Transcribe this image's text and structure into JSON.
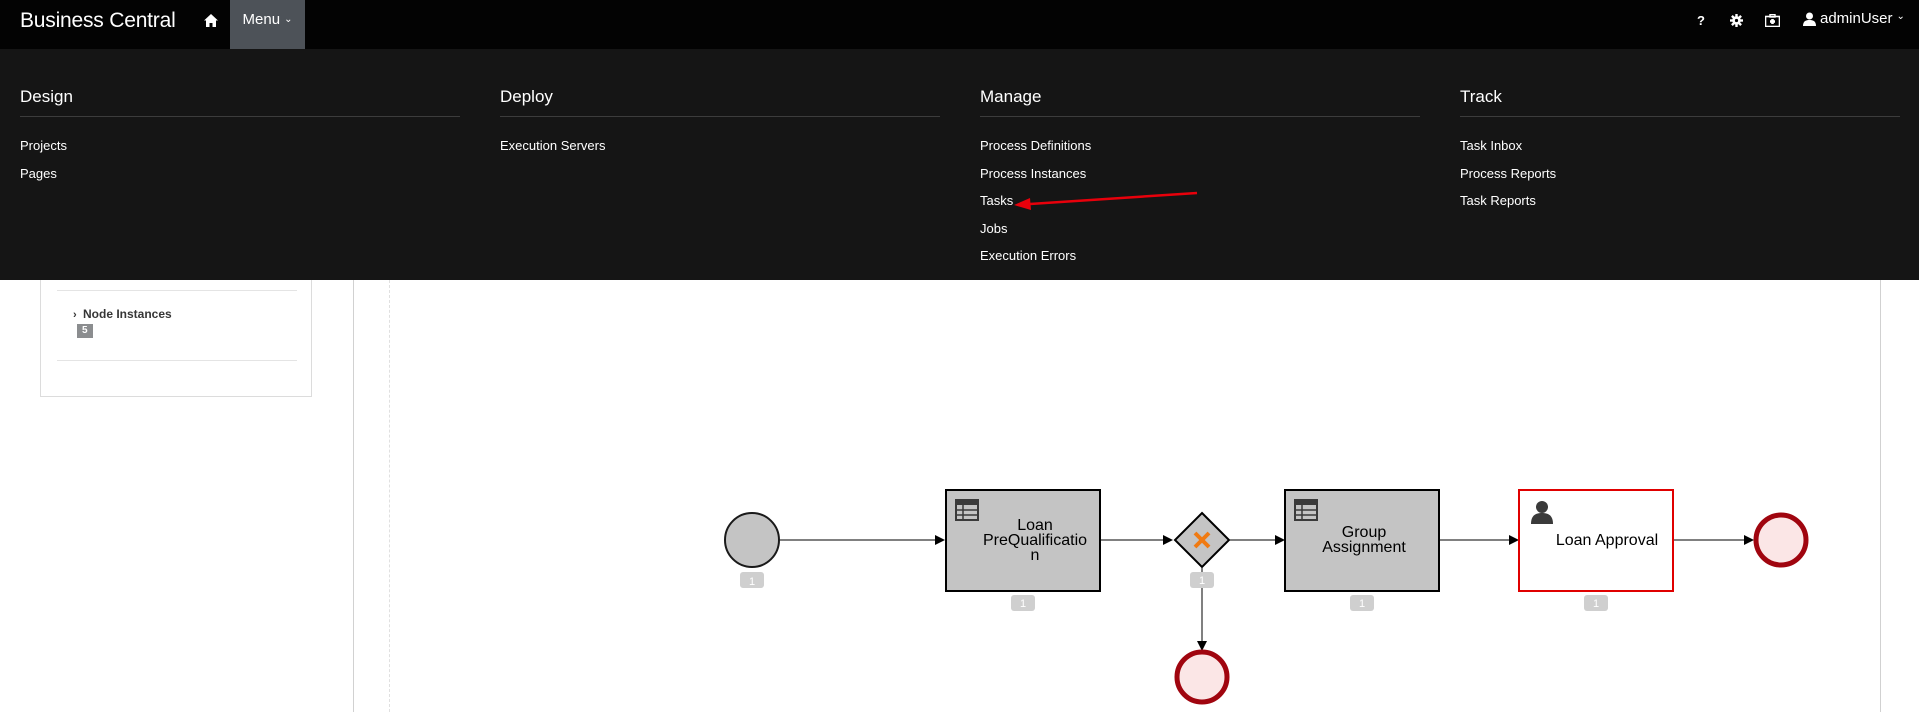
{
  "app": {
    "title": "Business Central"
  },
  "topbar": {
    "menu_label": "Menu",
    "user_name": "adminUser",
    "help_glyph": "?"
  },
  "menu": {
    "design": {
      "title": "Design",
      "items": [
        "Projects",
        "Pages"
      ]
    },
    "deploy": {
      "title": "Deploy",
      "items": [
        "Execution Servers"
      ]
    },
    "manage": {
      "title": "Manage",
      "items": [
        "Process Definitions",
        "Process Instances",
        "Tasks",
        "Jobs",
        "Execution Errors"
      ]
    },
    "track": {
      "title": "Track",
      "items": [
        "Task Inbox",
        "Process Reports",
        "Task Reports"
      ]
    }
  },
  "sidebar": {
    "node_instances_label": "Node Instances",
    "node_instances_count": "5"
  },
  "diagram": {
    "tasks": {
      "prequal": [
        "Loan",
        "PreQualificatio",
        "n"
      ],
      "group": [
        "Group",
        "Assignment"
      ],
      "approval": "Loan Approval"
    },
    "badges": {
      "start": "1",
      "prequal": "1",
      "gateway": "1",
      "group": "1",
      "approval": "1"
    }
  },
  "colors": {
    "topbar": "#030303",
    "menu_bg": "#151515",
    "menu_active": "#4d5258",
    "annotation_arrow": "#e8000b",
    "gateway_x": "#f07a12",
    "end_event_border": "#a0050f",
    "end_event_fill": "#fbe6e6",
    "active_task_border": "#e00000"
  }
}
